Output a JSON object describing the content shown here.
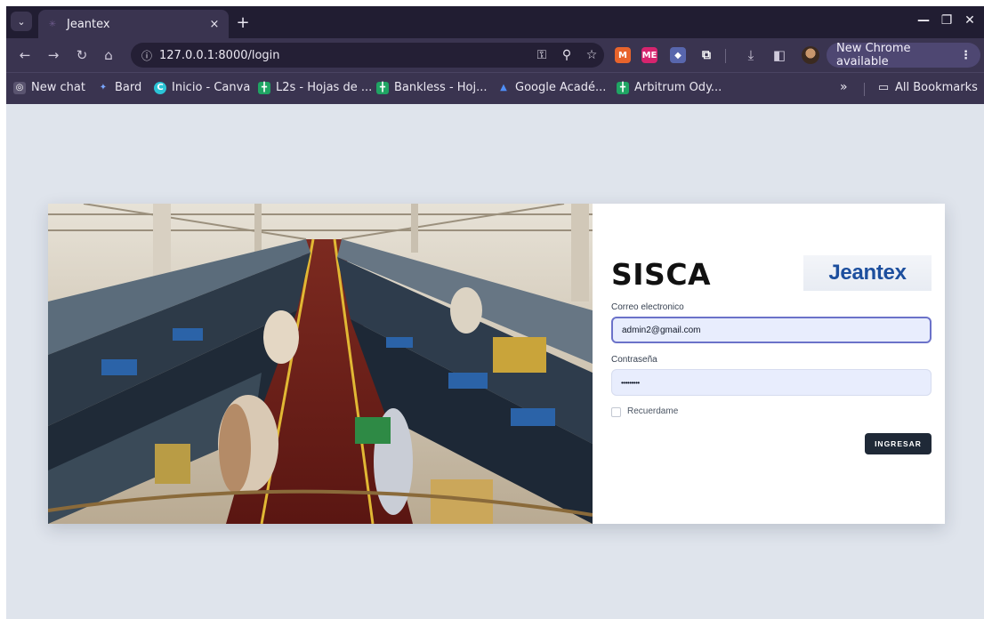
{
  "browser": {
    "tab": {
      "title": "Jeantex",
      "close": "×"
    },
    "new_tab": "+",
    "window_controls": {
      "minimize": "—",
      "restore": "❐",
      "close": "✕"
    },
    "nav": {
      "back": "←",
      "forward": "→",
      "reload": "↻",
      "home": "⌂"
    },
    "url": "127.0.0.1:8000/login",
    "omnibox_icons": {
      "key": "⚿",
      "zoom": "⚲",
      "star": "☆"
    },
    "extensions": [
      {
        "label": "M",
        "color": "#e8642c",
        "icon": "metamask-icon"
      },
      {
        "label": "ME",
        "color": "#d6246e",
        "icon": "magiceden-icon"
      },
      {
        "label": "◆",
        "color": "#5866ad",
        "icon": "wallet-icon"
      },
      {
        "label": "⧉",
        "color": "#3a3450",
        "icon": "puzzle-icon"
      }
    ],
    "download": "⤓",
    "sidepanel": "◧",
    "update_button": {
      "label": "New Chrome available",
      "dots": "⋮"
    },
    "bookmarks": [
      {
        "label": "New chat",
        "icon": "chatgpt-icon",
        "glyph": "◎",
        "color": "#ffffff"
      },
      {
        "label": "Bard",
        "icon": "bard-icon",
        "glyph": "✦",
        "color": "#7aa7ff"
      },
      {
        "label": "Inicio - Canva",
        "icon": "canva-icon",
        "glyph": "C",
        "color": "#2bc4d6"
      },
      {
        "label": "L2s - Hojas de ...",
        "icon": "sheets-icon",
        "glyph": "╋",
        "color": "#1fa463"
      },
      {
        "label": "Bankless - Hoj...",
        "icon": "sheets-icon",
        "glyph": "╋",
        "color": "#1fa463"
      },
      {
        "label": "Google Acadé...",
        "icon": "scholar-icon",
        "glyph": "▲",
        "color": "#4f8ef7"
      },
      {
        "label": "Arbitrum Ody...",
        "icon": "sheets-icon",
        "glyph": "╋",
        "color": "#1fa463"
      }
    ],
    "bookmarks_more": "»",
    "all_bookmarks": "All Bookmarks"
  },
  "login": {
    "brand": "SISCA",
    "logo_text": "Jeantex",
    "email_label": "Correo electronico",
    "email_value": "admin2@gmail.com",
    "password_label": "Contraseña",
    "password_value": "•••••••••",
    "remember_label": "Recuerdame",
    "submit_label": "INGRESAR"
  },
  "colors": {
    "page_bg": "#dfe4ec",
    "input_bg": "#e8edfd",
    "button_bg": "#1f2937",
    "logo_blue": "#1d4f9e"
  }
}
